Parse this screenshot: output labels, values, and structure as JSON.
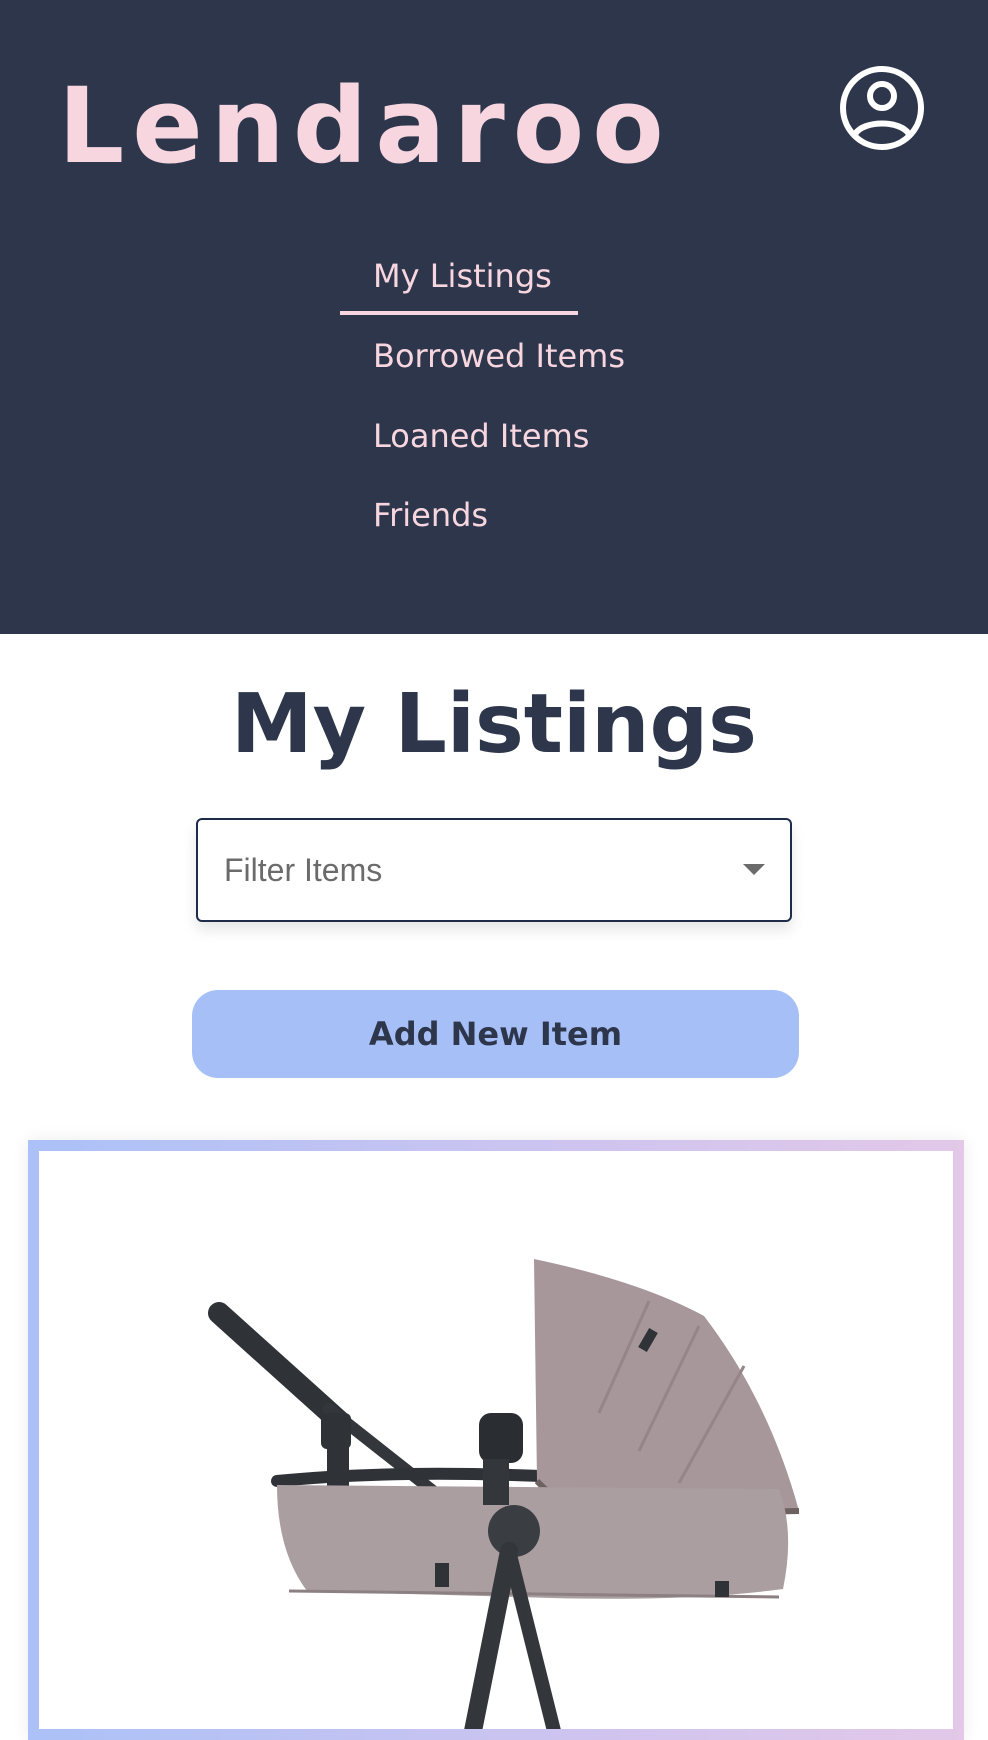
{
  "app": {
    "name": "Lendaroo"
  },
  "header": {
    "account_icon": "account-circle-icon"
  },
  "nav": {
    "items": [
      {
        "label": "My Listings",
        "active": true
      },
      {
        "label": "Borrowed Items",
        "active": false
      },
      {
        "label": "Loaned Items",
        "active": false
      },
      {
        "label": "Friends",
        "active": false
      }
    ]
  },
  "main": {
    "title": "My Listings",
    "filter": {
      "placeholder": "Filter Items",
      "icon": "dropdown-arrow-icon"
    },
    "add_button_label": "Add New Item",
    "listings": [
      {
        "image": "stroller-bassinet-photo"
      }
    ]
  },
  "colors": {
    "header_bg": "#2d364b",
    "header_text": "#f7d6df",
    "title_text": "#2d364b",
    "button_bg": "#a6c0f7",
    "card_border_start": "#abc1f7",
    "card_border_end": "#e3c8e8"
  }
}
